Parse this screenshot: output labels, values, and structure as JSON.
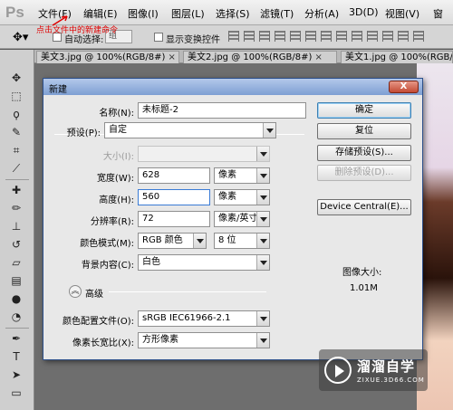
{
  "app": {
    "logo": "Ps"
  },
  "menu": [
    "文件(F)",
    "编辑(E)",
    "图像(I)",
    "图层(L)",
    "选择(S)",
    "滤镜(T)",
    "分析(A)",
    "3D(D)",
    "视图(V)",
    "窗"
  ],
  "annotation": "点击文件中的新建命令",
  "options": {
    "auto_select_label": "自动选择:",
    "auto_select_value": "组",
    "show_transform_label": "显示变换控件"
  },
  "tabs": [
    "美文3.jpg @ 100%(RGB/8#)",
    "美文2.jpg @ 100%(RGB/8#)",
    "美文1.jpg @ 100%(RGB/8"
  ],
  "tab_close": "×",
  "dialog": {
    "title": "新建",
    "close": "X",
    "name_label": "名称(N):",
    "name_value": "未标题-2",
    "preset_label": "预设(P):",
    "preset_value": "自定",
    "size_label": "大小(I):",
    "width_label": "宽度(W):",
    "width_value": "628",
    "width_unit": "像素",
    "height_label": "高度(H):",
    "height_value": "560",
    "height_unit": "像素",
    "resolution_label": "分辨率(R):",
    "resolution_value": "72",
    "resolution_unit": "像素/英寸",
    "color_mode_label": "颜色模式(M):",
    "color_mode_value": "RGB 颜色",
    "bit_depth_value": "8 位",
    "background_label": "背景内容(C):",
    "background_value": "白色",
    "advanced_label": "高级",
    "color_profile_label": "颜色配置文件(O):",
    "color_profile_value": "sRGB IEC61966-2.1",
    "pixel_aspect_label": "像素长宽比(X):",
    "pixel_aspect_value": "方形像素",
    "buttons": {
      "ok": "确定",
      "reset": "复位",
      "save_preset": "存储预设(S)...",
      "delete_preset": "删除预设(D)...",
      "device_central": "Device Central(E)..."
    },
    "image_size_label": "图像大小:",
    "image_size_value": "1.01M"
  },
  "watermark": {
    "name": "溜溜自学",
    "site": "ZIXUE.3D66.COM"
  },
  "colors": {
    "title_bar": "#7d9fd3",
    "close_button": "#c24a34",
    "annotation": "#e00000"
  }
}
